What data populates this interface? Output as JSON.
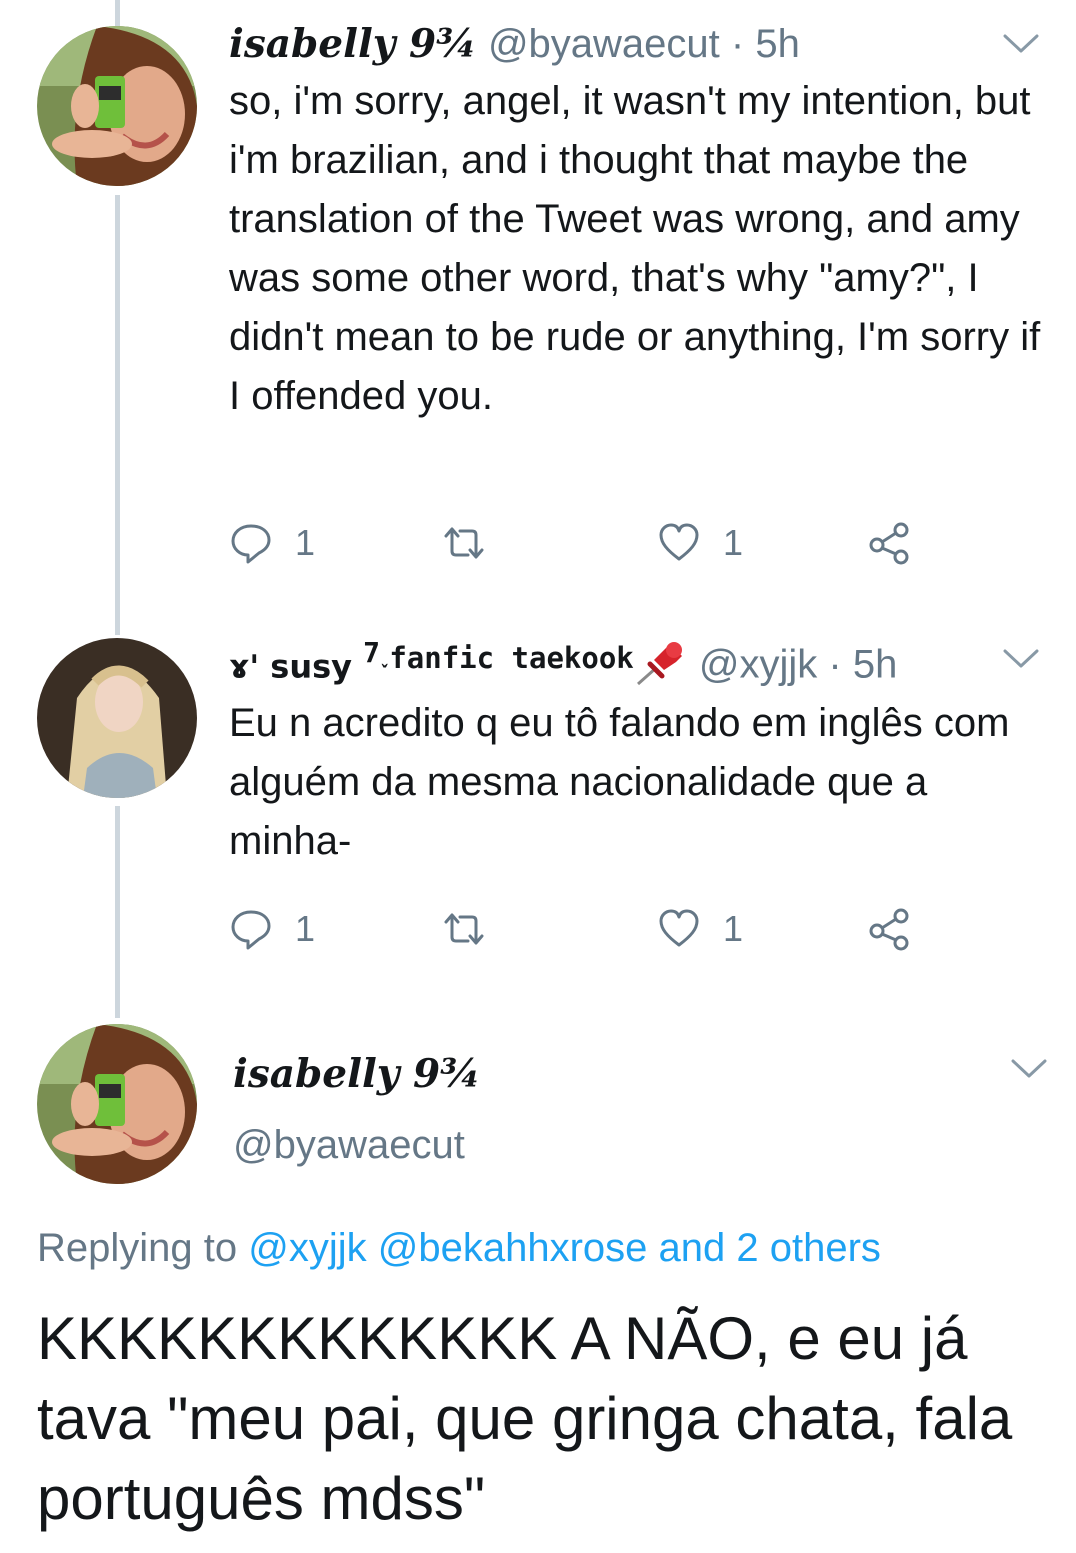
{
  "tweets": [
    {
      "name": "isabelly 9¾",
      "handle": "@byawaecut",
      "time": "5h",
      "text": "so, i'm sorry, angel, it wasn't my intention, but i'm brazilian, and i thought that maybe the translation of the Tweet was wrong, and amy was some other word, that's why \"amy?\", I didn't mean to be rude or anything, I'm sorry if I offended you.",
      "replies": "1",
      "likes": "1"
    },
    {
      "name_main": "ɤ' susy",
      "name_small": "7˯",
      "name_tail": "fanfic taekook",
      "handle": "@xyjjk",
      "time": "5h",
      "text": "Eu n acredito q eu tô falando em inglês com alguém da mesma nacionalidade que a minha-",
      "replies": "1",
      "likes": "1"
    }
  ],
  "main_tweet": {
    "name": "isabelly 9¾",
    "handle": "@byawaecut",
    "replying_prefix": "Replying to",
    "replying_to": "@xyjjk @bekahhxrose and 2 others",
    "text": "KKKKKKKKKKKKK A NÃO, e eu já tava \"meu pai, que gringa chata, fala português mdss\""
  },
  "separator": "·",
  "icons": [
    "reply-icon",
    "retweet-icon",
    "like-icon",
    "share-icon",
    "chevron-down-icon",
    "pushpin-icon"
  ],
  "colors": {
    "text": "#14171a",
    "muted": "#657786",
    "link": "#1da1f2",
    "thread_line": "#cdd6dd"
  }
}
